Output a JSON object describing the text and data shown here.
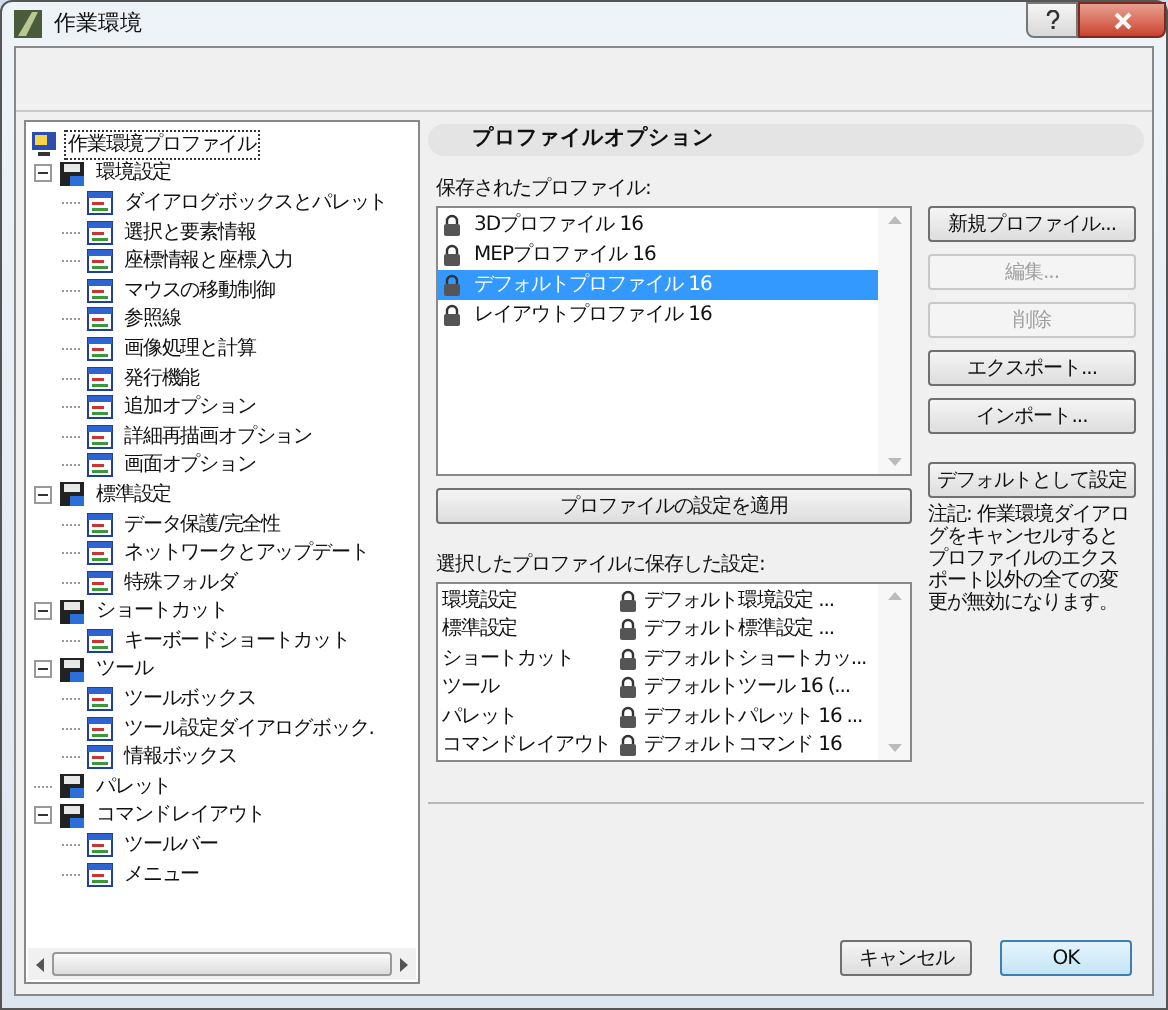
{
  "window": {
    "title": "作業環境"
  },
  "tree": {
    "label": "作業環境プロファイル",
    "selected": true,
    "children": [
      {
        "label": "環境設定",
        "selected": false,
        "expanded": true,
        "children": [
          {
            "label": "ダイアログボックスとパレット",
            "selected": false
          },
          {
            "label": "選択と要素情報",
            "selected": false
          },
          {
            "label": "座標情報と座標入力",
            "selected": false
          },
          {
            "label": "マウスの移動制御",
            "selected": false
          },
          {
            "label": "参照線",
            "selected": false
          },
          {
            "label": "画像処理と計算",
            "selected": false
          },
          {
            "label": "発行機能",
            "selected": false
          },
          {
            "label": "追加オプション",
            "selected": false
          },
          {
            "label": "詳細再描画オプション",
            "selected": false
          },
          {
            "label": "画面オプション",
            "selected": false
          }
        ]
      },
      {
        "label": "標準設定",
        "selected": false,
        "expanded": true,
        "children": [
          {
            "label": "データ保護/完全性",
            "selected": false
          },
          {
            "label": "ネットワークとアップデート",
            "selected": false
          },
          {
            "label": "特殊フォルダ",
            "selected": false
          }
        ]
      },
      {
        "label": "ショートカット",
        "selected": false,
        "expanded": true,
        "children": [
          {
            "label": "キーボードショートカット",
            "selected": false
          }
        ]
      },
      {
        "label": "ツール",
        "selected": false,
        "expanded": true,
        "children": [
          {
            "label": "ツールボックス",
            "selected": false
          },
          {
            "label": "ツール設定ダイアログボック.",
            "selected": false
          },
          {
            "label": "情報ボックス",
            "selected": false
          }
        ]
      },
      {
        "label": "パレット",
        "selected": false
      },
      {
        "label": "コマンドレイアウト",
        "selected": false,
        "expanded": true,
        "children": [
          {
            "label": "ツールバー",
            "selected": false
          },
          {
            "label": "メニュー",
            "selected": false
          }
        ]
      }
    ]
  },
  "section_title": "プロファイルオプション",
  "saved_profiles": {
    "label": "保存されたプロファイル:",
    "items": [
      {
        "name": "3Dプロファイル 16",
        "selected": false
      },
      {
        "name": "MEPプロファイル 16",
        "selected": false
      },
      {
        "name": "デフォルトプロファイル 16",
        "selected": true
      },
      {
        "name": "レイアウトプロファイル 16",
        "selected": false
      }
    ]
  },
  "side_buttons": [
    {
      "label": "新規プロファイル...",
      "disabled": false
    },
    {
      "label": "編集...",
      "disabled": true
    },
    {
      "label": "削除",
      "disabled": true
    },
    {
      "label": "エクスポート...",
      "disabled": false
    },
    {
      "label": "インポート...",
      "disabled": false
    }
  ],
  "set_default_button": "デフォルトとして設定",
  "note": "注記: 作業環境ダイアログをキャンセルするとプロファイルのエクスポート以外の全ての変更が無効になります。",
  "apply_button": "プロファイルの設定を適用",
  "stored_settings": {
    "label": "選択したプロファイルに保存した設定:",
    "rows": [
      {
        "setting": "環境設定",
        "profile": "デフォルト環境設定 ..."
      },
      {
        "setting": "標準設定",
        "profile": "デフォルト標準設定 ..."
      },
      {
        "setting": "ショートカット",
        "profile": "デフォルトショートカッ..."
      },
      {
        "setting": "ツール",
        "profile": "デフォルトツール 16 (..."
      },
      {
        "setting": "パレット",
        "profile": "デフォルトパレット 16 ..."
      },
      {
        "setting": "コマンドレイアウト",
        "profile": "デフォルトコマンド 16"
      }
    ]
  },
  "buttons": [
    {
      "label": "キャンセル",
      "kind": "cancel"
    },
    {
      "label": "OK",
      "kind": "default"
    }
  ]
}
